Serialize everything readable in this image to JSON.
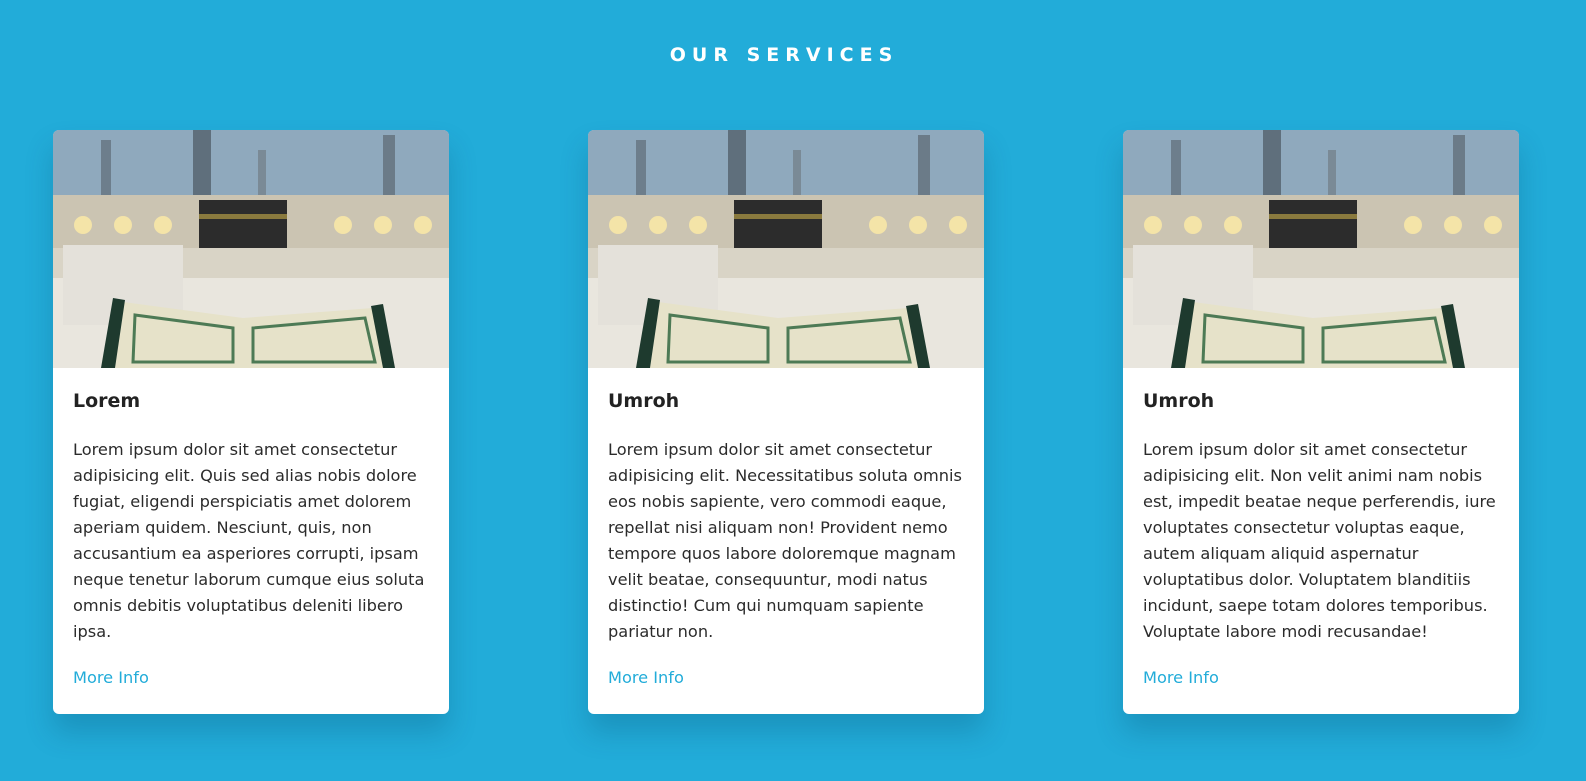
{
  "section": {
    "title": "OUR SERVICES"
  },
  "cards": [
    {
      "title": "Lorem",
      "text": "Lorem ipsum dolor sit amet consectetur adipisicing elit. Quis sed alias nobis dolore fugiat, eligendi perspiciatis amet dolorem aperiam quidem. Nesciunt, quis, non accusantium ea asperiores corrupti, ipsam neque tenetur laborum cumque eius soluta omnis debitis voluptatibus deleniti libero ipsa.",
      "link_label": "More Info"
    },
    {
      "title": "Umroh",
      "text": "Lorem ipsum dolor sit amet consectetur adipisicing elit. Necessitatibus soluta omnis eos nobis sapiente, vero commodi eaque, repellat nisi aliquam non! Provident nemo tempore quos labore doloremque magnam velit beatae, consequuntur, modi natus distinctio! Cum qui numquam sapiente pariatur non.",
      "link_label": "More Info"
    },
    {
      "title": "Umroh",
      "text": "Lorem ipsum dolor sit amet consectetur adipisicing elit. Non velit animi nam nobis est, impedit beatae neque perferendis, iure voluptates consectetur voluptas eaque, autem aliquam aliquid aspernatur voluptatibus dolor. Voluptatem blanditiis incidunt, saepe totam dolores temporibus. Voluptate labore modi recusandae!",
      "link_label": "More Info"
    }
  ],
  "colors": {
    "background": "#22acd9",
    "accent": "#22acd9",
    "card": "#ffffff",
    "heading_text": "#222222",
    "body_text": "#2b2b2b"
  }
}
